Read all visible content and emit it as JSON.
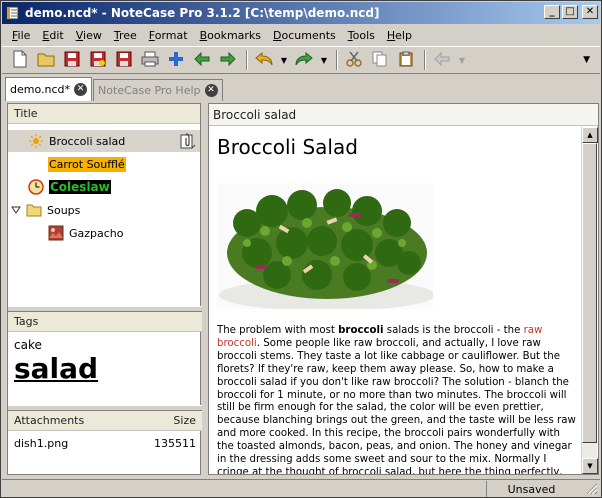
{
  "window": {
    "title": "demo.ncd* - NoteCase Pro 3.1.2 [C:\\temp\\demo.ncd]",
    "minimize": "_",
    "maximize": "□",
    "close": "✕"
  },
  "menu": {
    "items": [
      {
        "mnemonic": "F",
        "rest": "ile"
      },
      {
        "mnemonic": "E",
        "rest": "dit"
      },
      {
        "mnemonic": "V",
        "rest": "iew"
      },
      {
        "mnemonic": "T",
        "rest": "ree"
      },
      {
        "mnemonic": "F",
        "rest": "ormat"
      },
      {
        "mnemonic": "B",
        "rest": "ookmarks"
      },
      {
        "mnemonic": "D",
        "rest": "ocuments"
      },
      {
        "mnemonic": "T",
        "rest": "ools"
      },
      {
        "mnemonic": "H",
        "rest": "elp"
      }
    ]
  },
  "toolbar": {
    "icons": [
      "new-document-icon",
      "open-folder-icon",
      "save-icon",
      "save-as-icon",
      "save-all-icon",
      "print-icon",
      "add-node-icon",
      "back-arrow-icon",
      "forward-arrow-icon",
      "undo-icon",
      "redo-icon",
      "cut-icon",
      "copy-icon",
      "paste-icon",
      "nav-back-icon"
    ]
  },
  "tabs": [
    {
      "label": "demo.ncd*",
      "active": true
    },
    {
      "label": "NoteCase Pro Help",
      "active": false
    }
  ],
  "tree": {
    "header": "Title",
    "items": [
      {
        "label": "Broccoli salad",
        "icon": "sun-icon",
        "selected": true
      },
      {
        "label": "Carrot Soufflé",
        "icon": "none",
        "highlight": "#f5b000"
      },
      {
        "label": "Coleslaw",
        "icon": "clock-icon",
        "highlight": "#000000",
        "color": "#22c022"
      },
      {
        "label": "Soups",
        "icon": "folder-icon",
        "expanded": true
      },
      {
        "label": "Gazpacho",
        "icon": "picture-icon",
        "child": true
      }
    ]
  },
  "tags": {
    "header": "Tags",
    "items": [
      "cake",
      "salad"
    ]
  },
  "attachments": {
    "header": "Attachments",
    "size_header": "Size",
    "items": [
      {
        "name": "dish1.png",
        "size": "135511"
      }
    ]
  },
  "note": {
    "caption": "Broccoli salad",
    "title": "Broccoli Salad",
    "p1_a": "The problem with most ",
    "p1_b": "broccoli",
    "p1_c": " salads is the broccoli - the ",
    "p1_d": "raw broccoli",
    "p1_e": ".  Some people like raw broccoli, and actually, I love raw broccoli stems.  They taste a lot like cabbage or cauliflower.  But the florets?  If they're raw, keep them away please.  So, how to make a broccoli salad if you don't like raw broccoli?  The solution - blanch the broccoli for 1 minute, or no more than two minutes.  The broccoli will still be firm enough for the salad, the color will be even prettier, because blanching brings out the green, and the taste will be less raw and more cooked.  In this recipe, the broccoli pairs wonderfully with the toasted almonds, bacon, peas, and onion.  The honey and vinegar in the dressing adds some sweet and sour to the mix.  Normally I cringe at the thought of broccoli salad, but here the thing perfectly, the traditional, broccoli recipe fits the ruse."
  },
  "status": {
    "state": "Unsaved"
  }
}
